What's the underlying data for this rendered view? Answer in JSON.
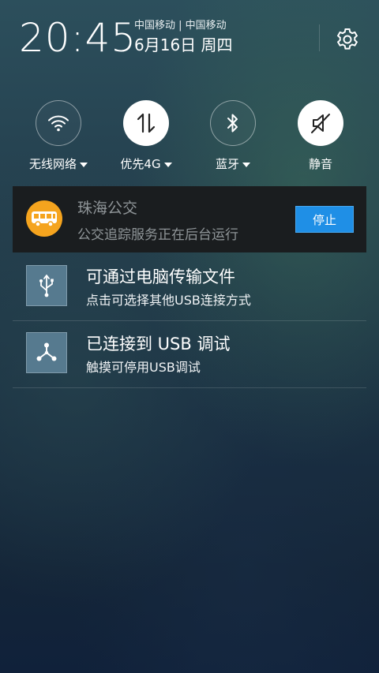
{
  "header": {
    "time": "20:45",
    "carrier": "中国移动 | 中国移动",
    "date": "6月16日 周四"
  },
  "icons": {
    "settings": "gear-icon",
    "wifi": "wifi-icon",
    "data": "mobile-data-arrows-icon",
    "bluetooth": "bluetooth-icon",
    "mute": "speaker-muted-icon",
    "bus": "bus-icon",
    "usb": "usb-icon",
    "debug": "usb-debug-icon"
  },
  "toggles": [
    {
      "label": "无线网络",
      "state": "off",
      "has_dropdown": true
    },
    {
      "label": "优先4G",
      "state": "on",
      "has_dropdown": true
    },
    {
      "label": "蓝牙",
      "state": "off",
      "has_dropdown": true
    },
    {
      "label": "静音",
      "state": "on",
      "has_dropdown": false
    }
  ],
  "bus_notification": {
    "app_name": "珠海公交",
    "text": "公交追踪服务正在后台运行",
    "stop_label": "停止",
    "accent": "#f5a41e",
    "button_color": "#1f8fe6"
  },
  "usb_notifications": [
    {
      "title": "可通过电脑传输文件",
      "text": "点击可选择其他USB连接方式"
    },
    {
      "title": "已连接到 USB 调试",
      "text": "触摸可停用USB调试"
    }
  ]
}
